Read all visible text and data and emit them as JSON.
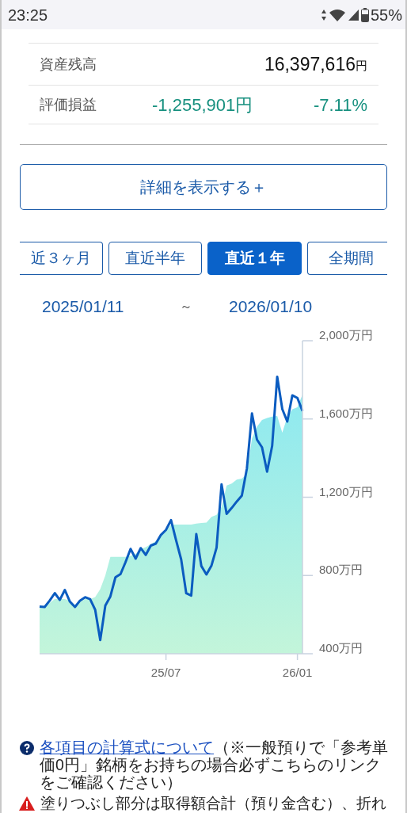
{
  "status_bar": {
    "time": "23:25",
    "battery": "55%"
  },
  "summary": [
    {
      "kind": "balance",
      "label": "資産残高",
      "value": "16,397,616",
      "unit": "円"
    },
    {
      "kind": "gain",
      "label": "評価損益",
      "value": "-1,255,901円",
      "percent": "-7.11%"
    }
  ],
  "details_button": "詳細を表示する＋",
  "period_tabs": [
    {
      "label": "近３ヶ月",
      "selected": false
    },
    {
      "label": "直近半年",
      "selected": false
    },
    {
      "label": "直近１年",
      "selected": true
    },
    {
      "label": "全期間",
      "selected": false
    }
  ],
  "date_range": {
    "from": "2025/01/11",
    "separator": "～",
    "to": "2026/01/10"
  },
  "chart": {
    "chart_data": {
      "type": "line",
      "categories": [
        null,
        null,
        null,
        null,
        null,
        null,
        null,
        null,
        null,
        null,
        null,
        null,
        null,
        null,
        null,
        null,
        null,
        null,
        null,
        null,
        null,
        null,
        null,
        null,
        null,
        "25/07",
        null,
        null,
        null,
        null,
        null,
        null,
        null,
        null,
        null,
        null,
        null,
        null,
        null,
        null,
        null,
        null,
        null,
        null,
        null,
        null,
        null,
        null,
        null,
        null,
        null,
        "26/01",
        null
      ],
      "series": [
        {
          "type": "area",
          "color": "#8ee9f0",
          "values": [
            641,
            639,
            660,
            680,
            680,
            680,
            670,
            650,
            665,
            680,
            680,
            690,
            730,
            800,
            895,
            895,
            895,
            895,
            900,
            910,
            935,
            945,
            960,
            975,
            1000,
            1025,
            1060,
            1060,
            1060,
            1060,
            1060,
            1065,
            1068,
            1070,
            1100,
            1110,
            1150,
            1260,
            1270,
            1290,
            1295,
            1320,
            1500,
            1560,
            1595,
            1605,
            1612,
            1615,
            1530,
            1610,
            1650,
            1660,
            1725
          ]
        },
        {
          "type": "line",
          "color": "#0b5cc0",
          "values": [
            641,
            639,
            672,
            710,
            675,
            726,
            666,
            639,
            672,
            689,
            679,
            625,
            470,
            646,
            693,
            791,
            807,
            868,
            936,
            886,
            940,
            905,
            953,
            963,
            1007,
            1033,
            1083,
            980,
            882,
            709,
            697,
            1012,
            848,
            805,
            851,
            942,
            1266,
            1115,
            1145,
            1178,
            1208,
            1347,
            1628,
            1495,
            1455,
            1331,
            1462,
            1816,
            1651,
            1587,
            1721,
            1707,
            1641
          ]
        }
      ],
      "ylim": [
        400,
        2000
      ],
      "yticks": [
        {
          "value": 2000,
          "label": "2,000万円"
        },
        {
          "value": 1600,
          "label": "1,600万円"
        },
        {
          "value": 1200,
          "label": "1,200万円"
        },
        {
          "value": 800,
          "label": "800万円"
        },
        {
          "value": 400,
          "label": "400万円"
        }
      ]
    }
  },
  "notes": [
    {
      "kind": "help",
      "link": "各項目の計算式について",
      "text": "（※一般預りで「参考単価0円」銘柄をお持ちの場合必ずこちらのリンクをご確認ください）"
    },
    {
      "kind": "warning",
      "text": "塗りつぶし部分は取得額合計（預り金含む）、折れ"
    }
  ]
}
